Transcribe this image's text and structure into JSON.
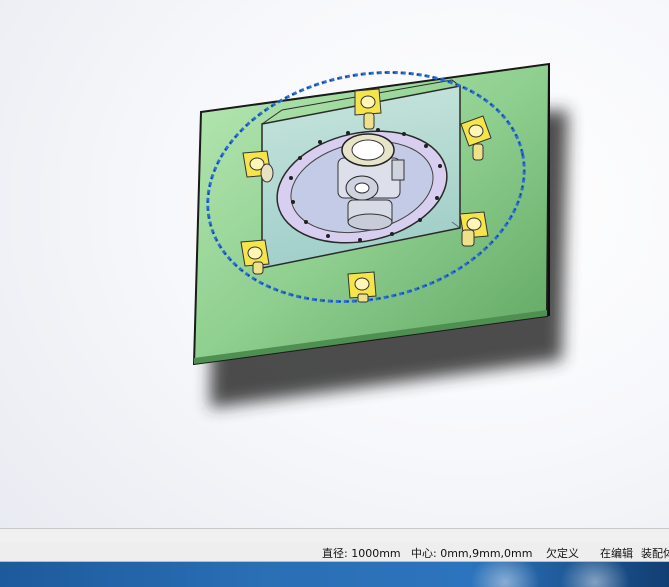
{
  "status_bar": {
    "diameter": "直径: 1000mm",
    "center": "中心: 0mm,9mm,0mm",
    "definition_state": "欠定义",
    "edit_state": "在编辑",
    "assembly_label": "装配体"
  },
  "colors": {
    "plate_fill": "#8fcf8f",
    "sketch_circle": "#2d6fd0",
    "caster_yellow": "#f5e44a",
    "taskbar_blue": "#2b6fb5"
  },
  "icons": [
    "cad-model",
    "sketch-circle",
    "caster-wheel"
  ]
}
